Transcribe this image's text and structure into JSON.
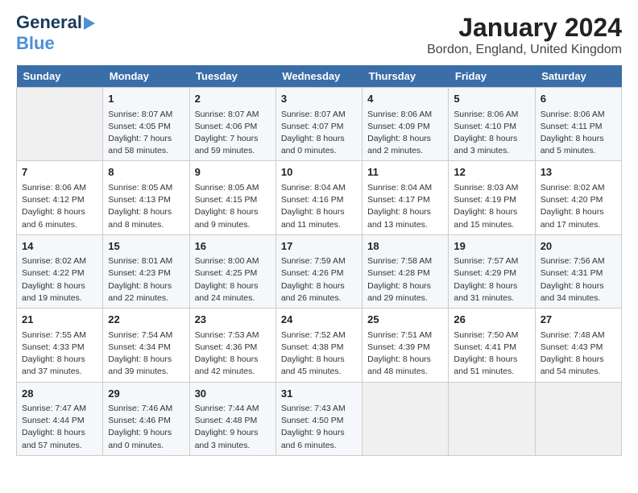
{
  "header": {
    "logo_line1": "General",
    "logo_line2": "Blue",
    "month_year": "January 2024",
    "location": "Bordon, England, United Kingdom"
  },
  "days_of_week": [
    "Sunday",
    "Monday",
    "Tuesday",
    "Wednesday",
    "Thursday",
    "Friday",
    "Saturday"
  ],
  "weeks": [
    [
      {
        "day": "",
        "content": ""
      },
      {
        "day": "1",
        "content": "Sunrise: 8:07 AM\nSunset: 4:05 PM\nDaylight: 7 hours\nand 58 minutes."
      },
      {
        "day": "2",
        "content": "Sunrise: 8:07 AM\nSunset: 4:06 PM\nDaylight: 7 hours\nand 59 minutes."
      },
      {
        "day": "3",
        "content": "Sunrise: 8:07 AM\nSunset: 4:07 PM\nDaylight: 8 hours\nand 0 minutes."
      },
      {
        "day": "4",
        "content": "Sunrise: 8:06 AM\nSunset: 4:09 PM\nDaylight: 8 hours\nand 2 minutes."
      },
      {
        "day": "5",
        "content": "Sunrise: 8:06 AM\nSunset: 4:10 PM\nDaylight: 8 hours\nand 3 minutes."
      },
      {
        "day": "6",
        "content": "Sunrise: 8:06 AM\nSunset: 4:11 PM\nDaylight: 8 hours\nand 5 minutes."
      }
    ],
    [
      {
        "day": "7",
        "content": "Sunrise: 8:06 AM\nSunset: 4:12 PM\nDaylight: 8 hours\nand 6 minutes."
      },
      {
        "day": "8",
        "content": "Sunrise: 8:05 AM\nSunset: 4:13 PM\nDaylight: 8 hours\nand 8 minutes."
      },
      {
        "day": "9",
        "content": "Sunrise: 8:05 AM\nSunset: 4:15 PM\nDaylight: 8 hours\nand 9 minutes."
      },
      {
        "day": "10",
        "content": "Sunrise: 8:04 AM\nSunset: 4:16 PM\nDaylight: 8 hours\nand 11 minutes."
      },
      {
        "day": "11",
        "content": "Sunrise: 8:04 AM\nSunset: 4:17 PM\nDaylight: 8 hours\nand 13 minutes."
      },
      {
        "day": "12",
        "content": "Sunrise: 8:03 AM\nSunset: 4:19 PM\nDaylight: 8 hours\nand 15 minutes."
      },
      {
        "day": "13",
        "content": "Sunrise: 8:02 AM\nSunset: 4:20 PM\nDaylight: 8 hours\nand 17 minutes."
      }
    ],
    [
      {
        "day": "14",
        "content": "Sunrise: 8:02 AM\nSunset: 4:22 PM\nDaylight: 8 hours\nand 19 minutes."
      },
      {
        "day": "15",
        "content": "Sunrise: 8:01 AM\nSunset: 4:23 PM\nDaylight: 8 hours\nand 22 minutes."
      },
      {
        "day": "16",
        "content": "Sunrise: 8:00 AM\nSunset: 4:25 PM\nDaylight: 8 hours\nand 24 minutes."
      },
      {
        "day": "17",
        "content": "Sunrise: 7:59 AM\nSunset: 4:26 PM\nDaylight: 8 hours\nand 26 minutes."
      },
      {
        "day": "18",
        "content": "Sunrise: 7:58 AM\nSunset: 4:28 PM\nDaylight: 8 hours\nand 29 minutes."
      },
      {
        "day": "19",
        "content": "Sunrise: 7:57 AM\nSunset: 4:29 PM\nDaylight: 8 hours\nand 31 minutes."
      },
      {
        "day": "20",
        "content": "Sunrise: 7:56 AM\nSunset: 4:31 PM\nDaylight: 8 hours\nand 34 minutes."
      }
    ],
    [
      {
        "day": "21",
        "content": "Sunrise: 7:55 AM\nSunset: 4:33 PM\nDaylight: 8 hours\nand 37 minutes."
      },
      {
        "day": "22",
        "content": "Sunrise: 7:54 AM\nSunset: 4:34 PM\nDaylight: 8 hours\nand 39 minutes."
      },
      {
        "day": "23",
        "content": "Sunrise: 7:53 AM\nSunset: 4:36 PM\nDaylight: 8 hours\nand 42 minutes."
      },
      {
        "day": "24",
        "content": "Sunrise: 7:52 AM\nSunset: 4:38 PM\nDaylight: 8 hours\nand 45 minutes."
      },
      {
        "day": "25",
        "content": "Sunrise: 7:51 AM\nSunset: 4:39 PM\nDaylight: 8 hours\nand 48 minutes."
      },
      {
        "day": "26",
        "content": "Sunrise: 7:50 AM\nSunset: 4:41 PM\nDaylight: 8 hours\nand 51 minutes."
      },
      {
        "day": "27",
        "content": "Sunrise: 7:48 AM\nSunset: 4:43 PM\nDaylight: 8 hours\nand 54 minutes."
      }
    ],
    [
      {
        "day": "28",
        "content": "Sunrise: 7:47 AM\nSunset: 4:44 PM\nDaylight: 8 hours\nand 57 minutes."
      },
      {
        "day": "29",
        "content": "Sunrise: 7:46 AM\nSunset: 4:46 PM\nDaylight: 9 hours\nand 0 minutes."
      },
      {
        "day": "30",
        "content": "Sunrise: 7:44 AM\nSunset: 4:48 PM\nDaylight: 9 hours\nand 3 minutes."
      },
      {
        "day": "31",
        "content": "Sunrise: 7:43 AM\nSunset: 4:50 PM\nDaylight: 9 hours\nand 6 minutes."
      },
      {
        "day": "",
        "content": ""
      },
      {
        "day": "",
        "content": ""
      },
      {
        "day": "",
        "content": ""
      }
    ]
  ]
}
